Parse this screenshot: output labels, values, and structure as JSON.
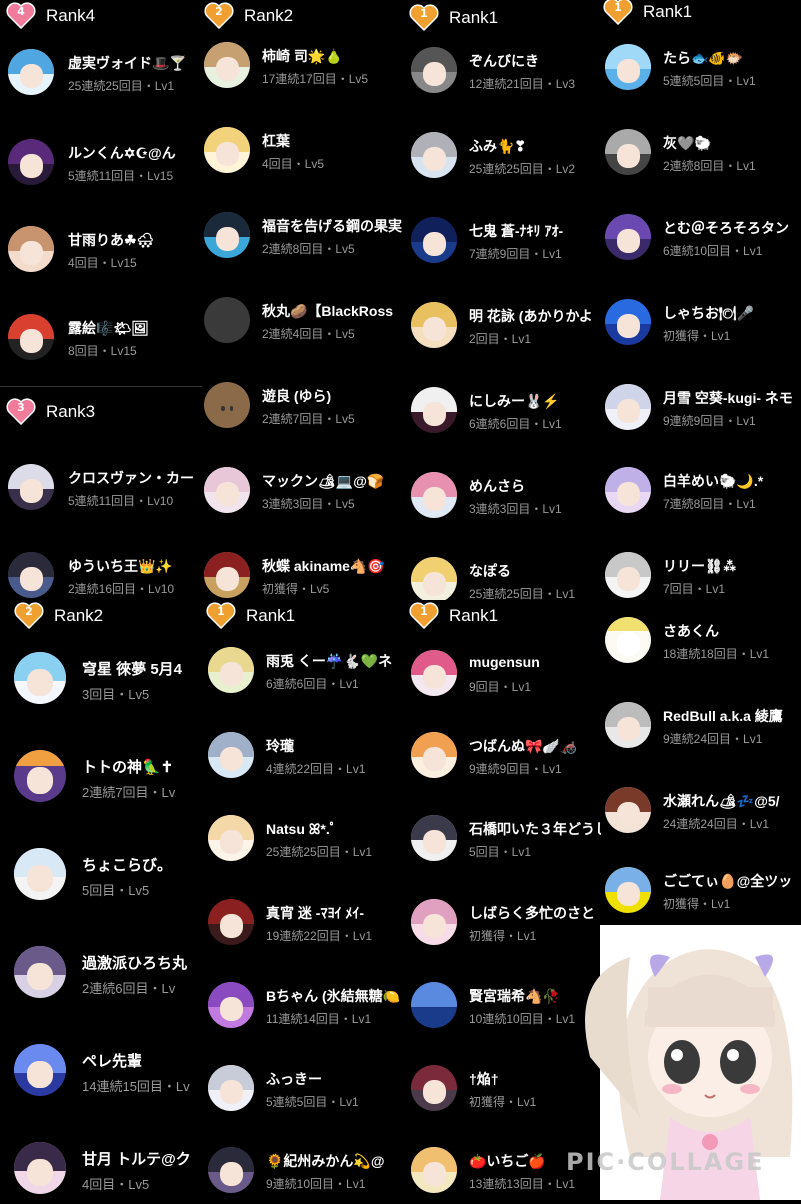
{
  "colors": {
    "background": "#000000",
    "heart": "#f07b9b",
    "heart_orange": "#f0a030",
    "meta_text": "#9a9a9a"
  },
  "panels": [
    {
      "rank_label": "Rank4",
      "heart_num": "4",
      "entries": [
        {
          "name": "虚実ヴォイド🎩🍸",
          "meta": "25連続25回目・Lv1"
        },
        {
          "name": "ルンくん✡☪@ん",
          "meta": "5連続11回目・Lv15"
        },
        {
          "name": "甘雨りあ☘🌨",
          "meta": "4回目・Lv15"
        },
        {
          "name": "露絵🎼🌤🖼",
          "meta": "8回目・Lv15"
        }
      ]
    },
    {
      "rank_label": "Rank3",
      "heart_num": "3",
      "entries": [
        {
          "name": "クロスヴァン・カー",
          "meta": "5連続11回目・Lv10"
        },
        {
          "name": "ゆういち王👑✨",
          "meta": "2連続16回目・Lv10"
        }
      ]
    },
    {
      "rank_label": "Rank2",
      "heart_num": "2",
      "entries": [
        {
          "name": "柿崎 司🌟🍐",
          "meta": "17連続17回目・Lv5"
        },
        {
          "name": "杠葉",
          "meta": "4回目・Lv5"
        },
        {
          "name": "福音を告げる鋼の果実",
          "meta": "2連続8回目・Lv5"
        },
        {
          "name": "秋丸🥔【BlackRoss",
          "meta": "2連続4回目・Lv5"
        },
        {
          "name": "遊良 (ゆら)",
          "meta": "2連続7回目・Lv5"
        },
        {
          "name": "マックン🏕💻@🍞",
          "meta": "3連続3回目・Lv5"
        },
        {
          "name": "秋蝶 akiname🐴🎯",
          "meta": "初獲得・Lv5"
        }
      ]
    },
    {
      "rank_label": "Rank1",
      "heart_num": "1",
      "entries": [
        {
          "name": "ぞんびにき",
          "meta": "12連続21回目・Lv3"
        },
        {
          "name": "ふみ🐈❣",
          "meta": "25連続25回目・Lv2"
        },
        {
          "name": "七鬼 蒼-ﾅｷﾘ ｱｵ-",
          "meta": "7連続9回目・Lv1"
        },
        {
          "name": "明 花詠 (あかりかよ",
          "meta": "2回目・Lv1"
        },
        {
          "name": "にしみー🐰⚡",
          "meta": "6連続6回目・Lv1"
        },
        {
          "name": "めんさら",
          "meta": "3連続3回目・Lv1"
        },
        {
          "name": "なぽる",
          "meta": "25連続25回目・Lv1"
        }
      ]
    },
    {
      "rank_label": "Rank1",
      "heart_num": "1",
      "entries": [
        {
          "name": "たら🐟🐠🐡",
          "meta": "5連続5回目・Lv1"
        },
        {
          "name": "灰🩶🐑",
          "meta": "2連続8回目・Lv1"
        },
        {
          "name": "とむ＠そろそろタン",
          "meta": "6連続10回目・Lv1"
        },
        {
          "name": "しゃちお🍽🎤",
          "meta": "初獲得・Lv1"
        },
        {
          "name": "月雪 空葵-kugi- ネモ",
          "meta": "9連続9回目・Lv1"
        },
        {
          "name": "白羊めい🐑🌙.*",
          "meta": "7連続8回目・Lv1"
        },
        {
          "name": "リリー⛓⁂",
          "meta": "7回目・Lv1"
        },
        {
          "name": "さあくん",
          "meta": "18連続18回目・Lv1"
        },
        {
          "name": "RedBull a.k.a 綾鷹",
          "meta": "9連続24回目・Lv1"
        },
        {
          "name": "水瀬れん🏕💤@5/",
          "meta": "24連続24回目・Lv1"
        },
        {
          "name": "ごごてぃ🥚@全ツッ",
          "meta": "初獲得・Lv1"
        }
      ]
    },
    {
      "rank_label": "Rank2",
      "heart_num": "2",
      "entries": [
        {
          "name": "穹星 徠夢 5月4",
          "meta": "3回目・Lv5"
        },
        {
          "name": "トトの神🦜✝",
          "meta": "2連続7回目・Lv"
        },
        {
          "name": "ちょこらび。",
          "meta": "5回目・Lv5"
        },
        {
          "name": "過激派ひろち丸",
          "meta": "2連続6回目・Lv"
        },
        {
          "name": "ペレ先輩",
          "meta": "14連続15回目・Lv"
        },
        {
          "name": "甘月 トルテ@ク",
          "meta": "4回目・Lv5"
        }
      ]
    },
    {
      "rank_label": "Rank1",
      "heart_num": "1",
      "entries": [
        {
          "name": "雨兎 くー☔🐇💚ネ",
          "meta": "6連続6回目・Lv1"
        },
        {
          "name": "玲瓏",
          "meta": "4連続22回目・Lv1"
        },
        {
          "name": "Natsu ꕤ*.ﾟ",
          "meta": "25連続25回目・Lv1"
        },
        {
          "name": "真宵 迷 -ﾏﾖｲ ﾒｲ-",
          "meta": "19連続22回目・Lv1"
        },
        {
          "name": "Bちゃん (氷結無糖🍋",
          "meta": "11連続14回目・Lv1"
        },
        {
          "name": "ふっきー",
          "meta": "5連続5回目・Lv1"
        },
        {
          "name": "🌻紀州みかん💫@",
          "meta": "9連続10回目・Lv1"
        }
      ]
    },
    {
      "rank_label": "Rank1",
      "heart_num": "1",
      "entries": [
        {
          "name": "mugensun",
          "meta": "9回目・Lv1"
        },
        {
          "name": "つばんぬ🎀🪽🦽",
          "meta": "9連続9回目・Lv1"
        },
        {
          "name": "石橋叩いた３年どうし",
          "meta": "5回目・Lv1"
        },
        {
          "name": "しばらく多忙のさと",
          "meta": "初獲得・Lv1"
        },
        {
          "name": "賢宮瑞希🐴🥀",
          "meta": "10連続10回目・Lv1"
        },
        {
          "name": "†焔†",
          "meta": "初獲得・Lv1"
        },
        {
          "name": "🍅いちご🍎",
          "meta": "13連続13回目・Lv1"
        }
      ]
    }
  ],
  "watermark": "PIC·COLLAGE"
}
